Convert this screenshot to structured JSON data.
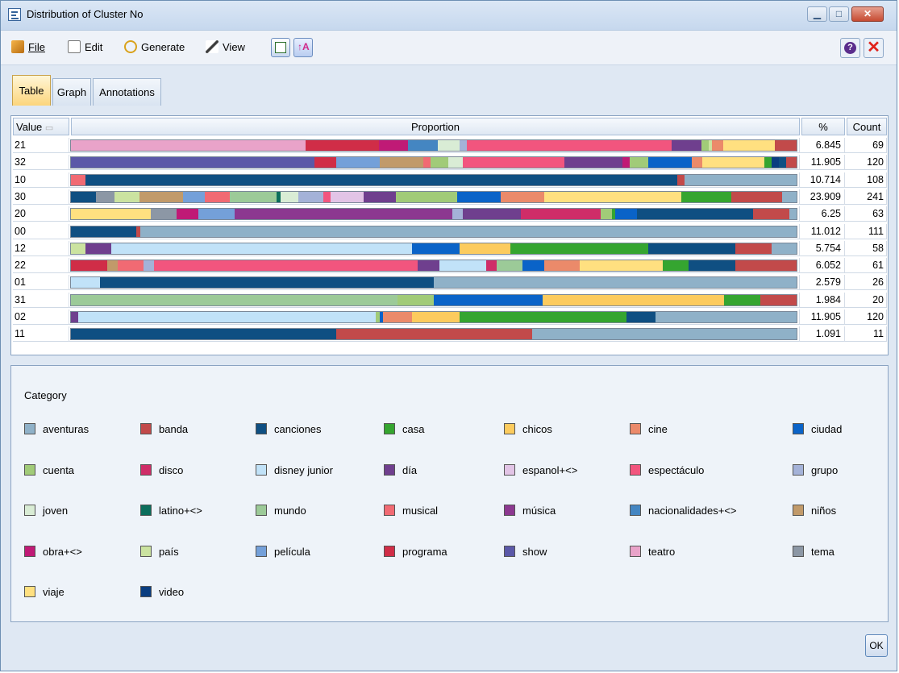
{
  "window": {
    "title": "Distribution of Cluster No",
    "ok_label": "OK"
  },
  "menu": {
    "file": "File",
    "edit": "Edit",
    "generate": "Generate",
    "view": "View"
  },
  "tabs": [
    "Table",
    "Graph",
    "Annotations"
  ],
  "table": {
    "headers": {
      "value": "Value",
      "proportion": "Proportion",
      "percent": "%",
      "count": "Count"
    },
    "rows": [
      {
        "value": "21",
        "percent": "6.845",
        "count": "69",
        "segments": [
          [
            "teatro",
            32
          ],
          [
            "programa",
            10
          ],
          [
            "obra+<>",
            4
          ],
          [
            "nacionalidades+<>",
            4
          ],
          [
            "joven",
            3
          ],
          [
            "grupo",
            1
          ],
          [
            "espectáculo",
            28
          ],
          [
            "día",
            4
          ],
          [
            "cuenta",
            1
          ],
          [
            "país",
            0.5
          ],
          [
            "cine",
            1.5
          ],
          [
            "viaje",
            7
          ],
          [
            "banda",
            3
          ]
        ]
      },
      {
        "value": "32",
        "percent": "11.905",
        "count": "120",
        "segments": [
          [
            "show",
            33.5
          ],
          [
            "programa",
            3
          ],
          [
            "película",
            6
          ],
          [
            "niños",
            6
          ],
          [
            "musical",
            1
          ],
          [
            "cuenta",
            2.5
          ],
          [
            "joven",
            2
          ],
          [
            "espectáculo",
            14
          ],
          [
            "día",
            8
          ],
          [
            "obra+<>",
            1
          ],
          [
            "cuenta",
            2.5
          ],
          [
            "ciudad",
            6
          ],
          [
            "cine",
            1.5
          ],
          [
            "viaje",
            8.5
          ],
          [
            "casa",
            1
          ],
          [
            "video",
            1
          ],
          [
            "canciones",
            1
          ],
          [
            "banda",
            1.5
          ]
        ]
      },
      {
        "value": "10",
        "percent": "10.714",
        "count": "108",
        "segments": [
          [
            "musical",
            2
          ],
          [
            "canciones",
            81.5
          ],
          [
            "banda",
            1
          ],
          [
            "aventuras",
            15.5
          ]
        ]
      },
      {
        "value": "30",
        "percent": "23.909",
        "count": "241",
        "segments": [
          [
            "canciones",
            3.5
          ],
          [
            "tema",
            2.5
          ],
          [
            "país",
            3.5
          ],
          [
            "niños",
            6
          ],
          [
            "película",
            3
          ],
          [
            "musical",
            3.5
          ],
          [
            "mundo",
            6.5
          ],
          [
            "latino+<>",
            0.5
          ],
          [
            "joven",
            2.5
          ],
          [
            "grupo",
            3.5
          ],
          [
            "espectáculo",
            1
          ],
          [
            "espanol+<>",
            4.5
          ],
          [
            "día",
            4.5
          ],
          [
            "cuenta",
            8.5
          ],
          [
            "ciudad",
            6
          ],
          [
            "cine",
            6
          ],
          [
            "viaje",
            19
          ],
          [
            "casa",
            7
          ],
          [
            "banda",
            7
          ],
          [
            "aventuras",
            2
          ]
        ]
      },
      {
        "value": "20",
        "percent": "6.25",
        "count": "63",
        "segments": [
          [
            "viaje",
            11
          ],
          [
            "tema",
            3.5
          ],
          [
            "obra+<>",
            3
          ],
          [
            "película",
            5
          ],
          [
            "música",
            30
          ],
          [
            "grupo",
            1.5
          ],
          [
            "día",
            8
          ],
          [
            "disco",
            11
          ],
          [
            "cuenta",
            1.5
          ],
          [
            "casa",
            0.5
          ],
          [
            "ciudad",
            3
          ],
          [
            "canciones",
            16
          ],
          [
            "banda",
            5
          ],
          [
            "aventuras",
            1
          ]
        ]
      },
      {
        "value": "00",
        "percent": "11.012",
        "count": "111",
        "segments": [
          [
            "canciones",
            9
          ],
          [
            "banda",
            0.5
          ],
          [
            "aventuras",
            90.5
          ]
        ]
      },
      {
        "value": "12",
        "percent": "5.754",
        "count": "58",
        "segments": [
          [
            "país",
            2
          ],
          [
            "día",
            3.5
          ],
          [
            "disney junior",
            41.5
          ],
          [
            "ciudad",
            6.5
          ],
          [
            "chicos",
            7
          ],
          [
            "casa",
            19
          ],
          [
            "canciones",
            12
          ],
          [
            "banda",
            5
          ],
          [
            "aventuras",
            3.5
          ]
        ]
      },
      {
        "value": "22",
        "percent": "6.052",
        "count": "61",
        "segments": [
          [
            "programa",
            5
          ],
          [
            "niños",
            1.5
          ],
          [
            "musical",
            3.5
          ],
          [
            "grupo",
            1.5
          ],
          [
            "espectáculo",
            36.5
          ],
          [
            "día",
            3
          ],
          [
            "disney junior",
            6.5
          ],
          [
            "disco",
            1.5
          ],
          [
            "mundo",
            3.5
          ],
          [
            "ciudad",
            3
          ],
          [
            "cine",
            5
          ],
          [
            "viaje",
            11.5
          ],
          [
            "casa",
            3.5
          ],
          [
            "canciones",
            6.5
          ],
          [
            "banda",
            8.5
          ]
        ]
      },
      {
        "value": "01",
        "percent": "2.579",
        "count": "26",
        "segments": [
          [
            "disney junior",
            4
          ],
          [
            "canciones",
            46
          ],
          [
            "aventuras",
            50
          ]
        ]
      },
      {
        "value": "31",
        "percent": "1.984",
        "count": "20",
        "segments": [
          [
            "mundo",
            45
          ],
          [
            "cuenta",
            5
          ],
          [
            "ciudad",
            15
          ],
          [
            "chicos",
            25
          ],
          [
            "casa",
            5
          ],
          [
            "banda",
            5
          ]
        ]
      },
      {
        "value": "02",
        "percent": "11.905",
        "count": "120",
        "segments": [
          [
            "día",
            1
          ],
          [
            "disney junior",
            41
          ],
          [
            "cuenta",
            0.5
          ],
          [
            "ciudad",
            0.5
          ],
          [
            "cine",
            4
          ],
          [
            "chicos",
            6.5
          ],
          [
            "casa",
            23
          ],
          [
            "canciones",
            4
          ],
          [
            "aventuras",
            19.5
          ]
        ]
      },
      {
        "value": "11",
        "percent": "1.091",
        "count": "11",
        "segments": [
          [
            "canciones",
            36.5
          ],
          [
            "banda",
            27
          ],
          [
            "aventuras",
            36.5
          ]
        ]
      }
    ]
  },
  "legend": {
    "title": "Category",
    "items": [
      {
        "label": "aventuras",
        "color": "#8fb1c8"
      },
      {
        "label": "banda",
        "color": "#c24a4a"
      },
      {
        "label": "canciones",
        "color": "#0f4f82"
      },
      {
        "label": "casa",
        "color": "#35a530"
      },
      {
        "label": "chicos",
        "color": "#fccb5e"
      },
      {
        "label": "cine",
        "color": "#eb8a6a"
      },
      {
        "label": "ciudad",
        "color": "#0a63c8"
      },
      {
        "label": "cuenta",
        "color": "#a1cb78"
      },
      {
        "label": "disco",
        "color": "#cf2d68"
      },
      {
        "label": "disney junior",
        "color": "#c1e2f8"
      },
      {
        "label": "día",
        "color": "#6f3f8e"
      },
      {
        "label": "espanol+<>",
        "color": "#e2c4e6"
      },
      {
        "label": "espectáculo",
        "color": "#f2557e"
      },
      {
        "label": "grupo",
        "color": "#a4b2d8"
      },
      {
        "label": "joven",
        "color": "#d9ecd5"
      },
      {
        "label": "latino+<>",
        "color": "#0c6e5c"
      },
      {
        "label": "mundo",
        "color": "#9cca98"
      },
      {
        "label": "musical",
        "color": "#f16a73"
      },
      {
        "label": "música",
        "color": "#8c3890"
      },
      {
        "label": "nacionalidades+<>",
        "color": "#4486c2"
      },
      {
        "label": "niños",
        "color": "#c19a6a"
      },
      {
        "label": "obra+<>",
        "color": "#c01a76"
      },
      {
        "label": "país",
        "color": "#cbe3a0"
      },
      {
        "label": "película",
        "color": "#74a0d9"
      },
      {
        "label": "programa",
        "color": "#d02d47"
      },
      {
        "label": "show",
        "color": "#5b58a8"
      },
      {
        "label": "teatro",
        "color": "#e9a3c9"
      },
      {
        "label": "tema",
        "color": "#8c97a5"
      },
      {
        "label": "viaje",
        "color": "#ffe080"
      },
      {
        "label": "video",
        "color": "#0a3d80"
      }
    ]
  }
}
